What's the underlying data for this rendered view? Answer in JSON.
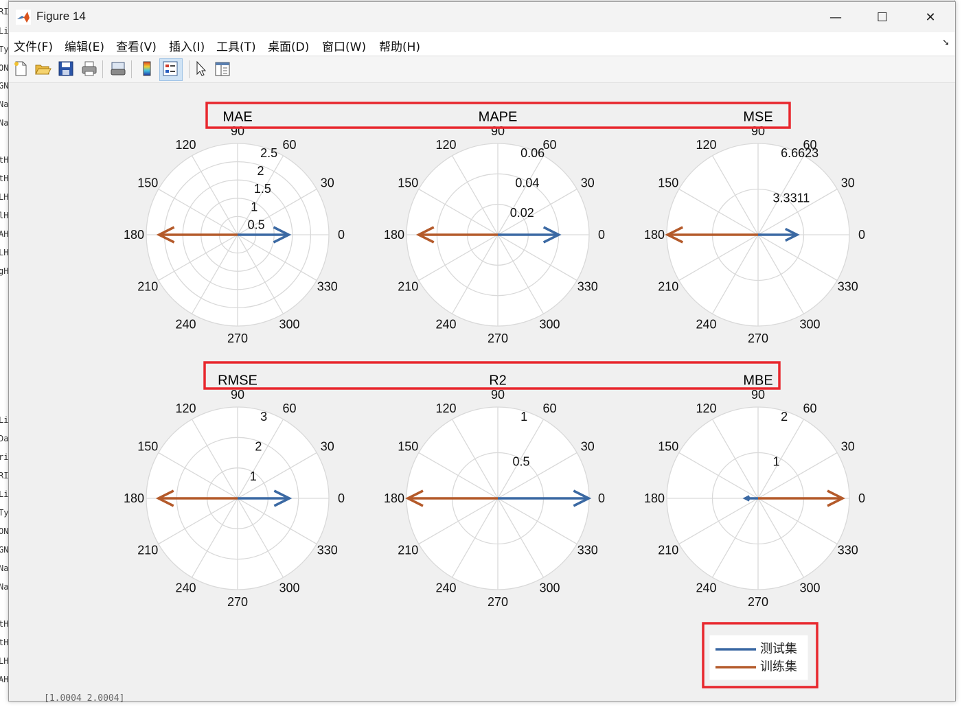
{
  "window": {
    "title": "Figure 14",
    "controls": {
      "minimize": "—",
      "maximize": "☐",
      "close": "✕"
    }
  },
  "menu": [
    "文件(F)",
    "编辑(E)",
    "查看(V)",
    "插入(I)",
    "工具(T)",
    "桌面(D)",
    "窗口(W)",
    "帮助(H)"
  ],
  "toolbar_icons": [
    "new-figure-icon",
    "open-file-icon",
    "save-icon",
    "print-icon",
    "print-preview-icon",
    "colorbar-icon",
    "legend-icon",
    "pointer-icon",
    "property-editor-icon"
  ],
  "background": {
    "left_fragments": [
      "RI",
      "Li",
      "Ty",
      "ON",
      "GN",
      "Na",
      "Na",
      "tH",
      "tH",
      "LH",
      "lH",
      "AH",
      "LH",
      "gH",
      "Li",
      "Da",
      "ri",
      "RI",
      "Li",
      "Ty",
      "ON",
      "GN",
      "Na",
      "Na",
      "tH",
      "tH",
      "LH",
      "AH"
    ],
    "bottom_fragment": "[1.0004 2.0004]"
  },
  "colors": {
    "test": "#3b69a3",
    "train": "#b45a2a",
    "grid": "#d9d9d9",
    "highlight": "#e8272d"
  },
  "chart_data": {
    "type": "polar_compass",
    "angle_labels": [
      "0",
      "30",
      "60",
      "90",
      "120",
      "150",
      "180",
      "210",
      "240",
      "270",
      "300",
      "330"
    ],
    "legend": [
      "测试集",
      "训练集"
    ],
    "charts": [
      {
        "title": "MAE",
        "rmax": 2.5,
        "rticks": [
          0.5,
          1,
          1.5,
          2,
          2.5
        ],
        "rlabels": [
          "0.5",
          "1",
          "1.5",
          "2",
          "2.5"
        ],
        "test": 1.4,
        "train": -2.15
      },
      {
        "title": "MAPE",
        "rmax": 0.06,
        "rticks": [
          0.02,
          0.04,
          0.06
        ],
        "rlabels": [
          "0.02",
          "0.04",
          "0.06"
        ],
        "test": 0.04,
        "train": -0.052
      },
      {
        "title": "MSE",
        "rmax": 6.6623,
        "rticks": [
          3.3311,
          6.6623
        ],
        "rlabels": [
          "3.3311",
          "6.6623"
        ],
        "test": 2.85,
        "train": -6.6
      },
      {
        "title": "RMSE",
        "rmax": 3,
        "rticks": [
          1,
          2,
          3
        ],
        "rlabels": [
          "1",
          "2",
          "3"
        ],
        "test": 1.7,
        "train": -2.6
      },
      {
        "title": "R2",
        "rmax": 1,
        "rticks": [
          0.5,
          1
        ],
        "rlabels": [
          "0.5",
          "1"
        ],
        "test": 0.995,
        "train": -0.985
      },
      {
        "title": "MBE",
        "rmax": 2,
        "rticks": [
          1,
          2
        ],
        "rlabels": [
          "1",
          "2"
        ],
        "test": -0.28,
        "train": 1.85
      }
    ]
  }
}
